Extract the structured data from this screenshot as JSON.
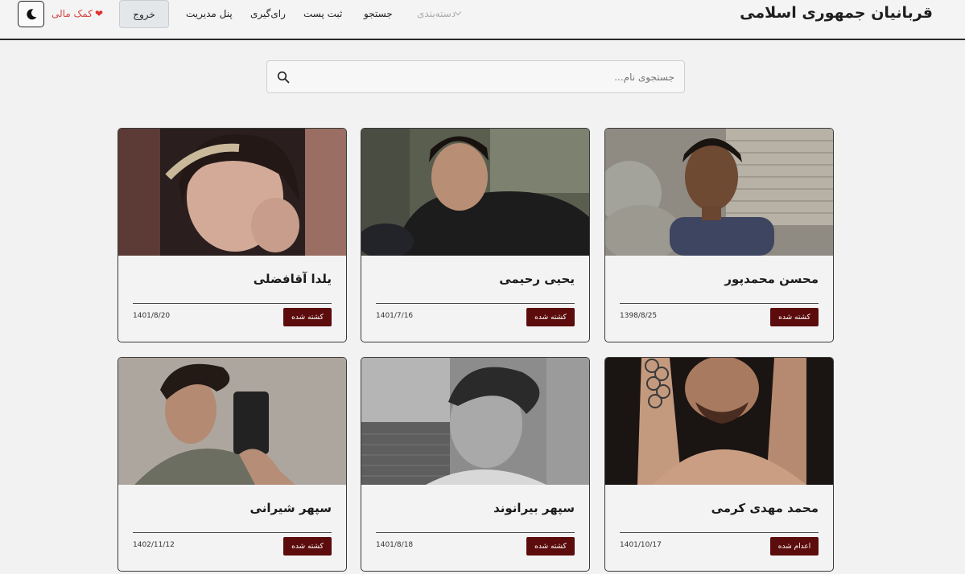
{
  "header": {
    "site_title": "قربانیان جمهوری اسلامی",
    "nav": {
      "categories": "دسته‌بندی",
      "search": "جستجو",
      "submit_post": "ثبت پست",
      "voting": "رای‌گیری",
      "admin_panel": "پنل مدیریت"
    },
    "logout_label": "خروج",
    "donate_label": "کمک مالی",
    "theme_icon": "moon-icon",
    "heart_icon": "heart-icon"
  },
  "search": {
    "placeholder": "جستجوی نام...",
    "value": "",
    "icon": "search-icon"
  },
  "cards": [
    {
      "name": "محسن محمدپور",
      "status": "کشته شده",
      "date": "1398/8/25"
    },
    {
      "name": "یحیی رحیمی",
      "status": "کشته شده",
      "date": "1401/7/16"
    },
    {
      "name": "یلدا آقافضلی",
      "status": "کشته شده",
      "date": "1401/8/20"
    },
    {
      "name": "محمد مهدی کرمی",
      "status": "اعدام شده",
      "date": "1401/10/17"
    },
    {
      "name": "سپهر بیرانوند",
      "status": "کشته شده",
      "date": "1401/8/18"
    },
    {
      "name": "سپهر شیرانی",
      "status": "کشته شده",
      "date": "1402/11/12"
    }
  ],
  "colors": {
    "badge_bg": "#5c0c0c",
    "donate_text": "#d64545",
    "page_bg": "#f2f2f3"
  }
}
